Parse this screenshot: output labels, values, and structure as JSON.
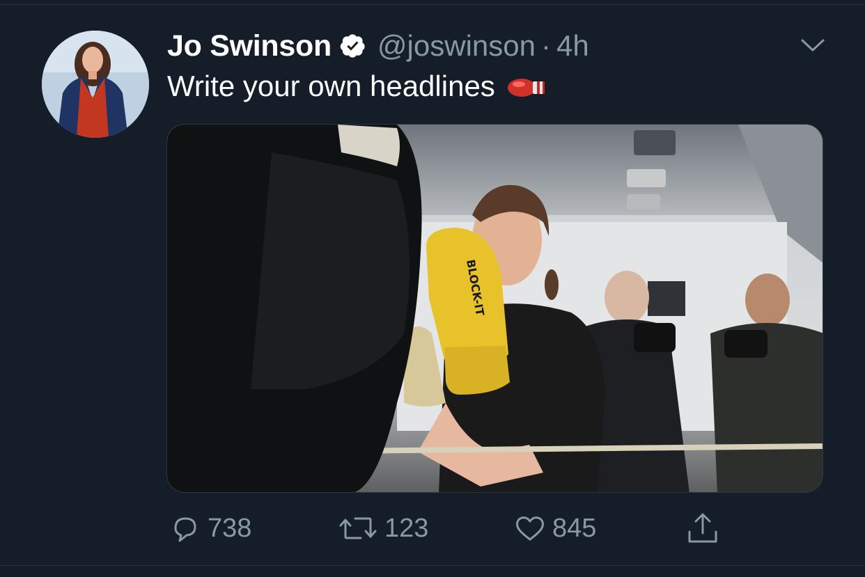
{
  "tweet": {
    "display_name": "Jo Swinson",
    "handle": "@joswinson",
    "separator": "·",
    "time": "4h",
    "text": "Write your own headlines",
    "emoji": "boxing-glove"
  },
  "media": {
    "glove_brand": "BLOCK-IT"
  },
  "actions": {
    "reply_count": "738",
    "retweet_count": "123",
    "like_count": "845"
  },
  "icons": {
    "verified": "verified-badge-icon",
    "more": "chevron-down-icon",
    "reply": "reply-icon",
    "retweet": "retweet-icon",
    "like": "heart-icon",
    "share": "share-icon"
  },
  "colors": {
    "background": "#151d28",
    "text_primary": "#ffffff",
    "text_secondary": "#8899a6",
    "divider": "#263241"
  }
}
